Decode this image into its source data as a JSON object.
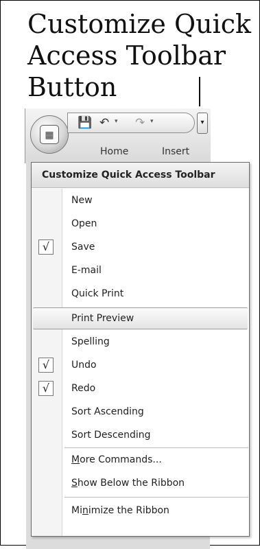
{
  "caption": {
    "line1": "Customize Quick",
    "line2": "Access Toolbar",
    "line3": "Button"
  },
  "ribbon": {
    "tabs": [
      "Home",
      "Insert"
    ]
  },
  "menu": {
    "title": "Customize Quick Access Toolbar",
    "items": [
      {
        "label": "New",
        "checked": false
      },
      {
        "label": "Open",
        "checked": false
      },
      {
        "label": "Save",
        "checked": true
      },
      {
        "label": "E-mail",
        "checked": false
      },
      {
        "label": "Quick Print",
        "checked": false
      },
      {
        "label": "Print Preview",
        "checked": false,
        "highlighted": true
      },
      {
        "label": "Spelling",
        "checked": false
      },
      {
        "label": "Undo",
        "checked": true
      },
      {
        "label": "Redo",
        "checked": true
      },
      {
        "label": "Sort Ascending",
        "checked": false
      },
      {
        "label": "Sort Descending",
        "checked": false
      }
    ],
    "more_commands": {
      "pre": "",
      "key": "M",
      "post": "ore Commands..."
    },
    "show_below": {
      "pre": "",
      "key": "S",
      "post": "how Below the Ribbon"
    },
    "minimize": {
      "pre": "Mi",
      "key": "n",
      "post": "imize the Ribbon"
    },
    "check_glyph": "√"
  }
}
